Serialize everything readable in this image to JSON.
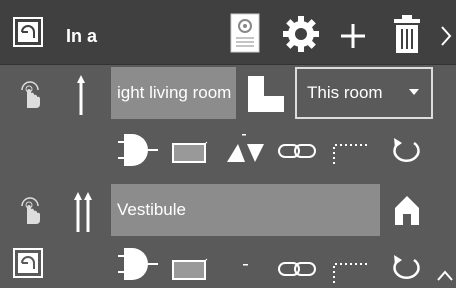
{
  "header": {
    "title": "In a",
    "icons": [
      "room-icon",
      "document-gear-icon",
      "gear-icon",
      "plus-icon",
      "trash-icon",
      "chevron-right-icon"
    ]
  },
  "rows": [
    {
      "name_value": "ight living room",
      "room_select": "This room",
      "icons": [
        "pointing-hand-icon",
        "single-arrow-up-icon",
        "l-shape-room-icon"
      ]
    },
    {
      "name_value": "Vestibule",
      "icons": [
        "pointing-hand-icon",
        "double-arrow-up-icon",
        "house-icon"
      ]
    }
  ],
  "tool_rows": [
    [
      "and-gate-icon",
      "box-icon",
      "triangles-icon",
      "link-icon",
      "dotted-corner-icon",
      "cycle-icon"
    ],
    [
      "and-gate-icon",
      "box-icon",
      "dot-icon",
      "link-icon",
      "dotted-corner-icon",
      "cycle-icon"
    ]
  ],
  "footer": {
    "icons": [
      "room-icon",
      "chevron-up-icon"
    ]
  },
  "colors": {
    "background": "#5a5a5a",
    "topbar": "#404040",
    "field": "#8c8c8c",
    "icon": "#ffffff"
  }
}
